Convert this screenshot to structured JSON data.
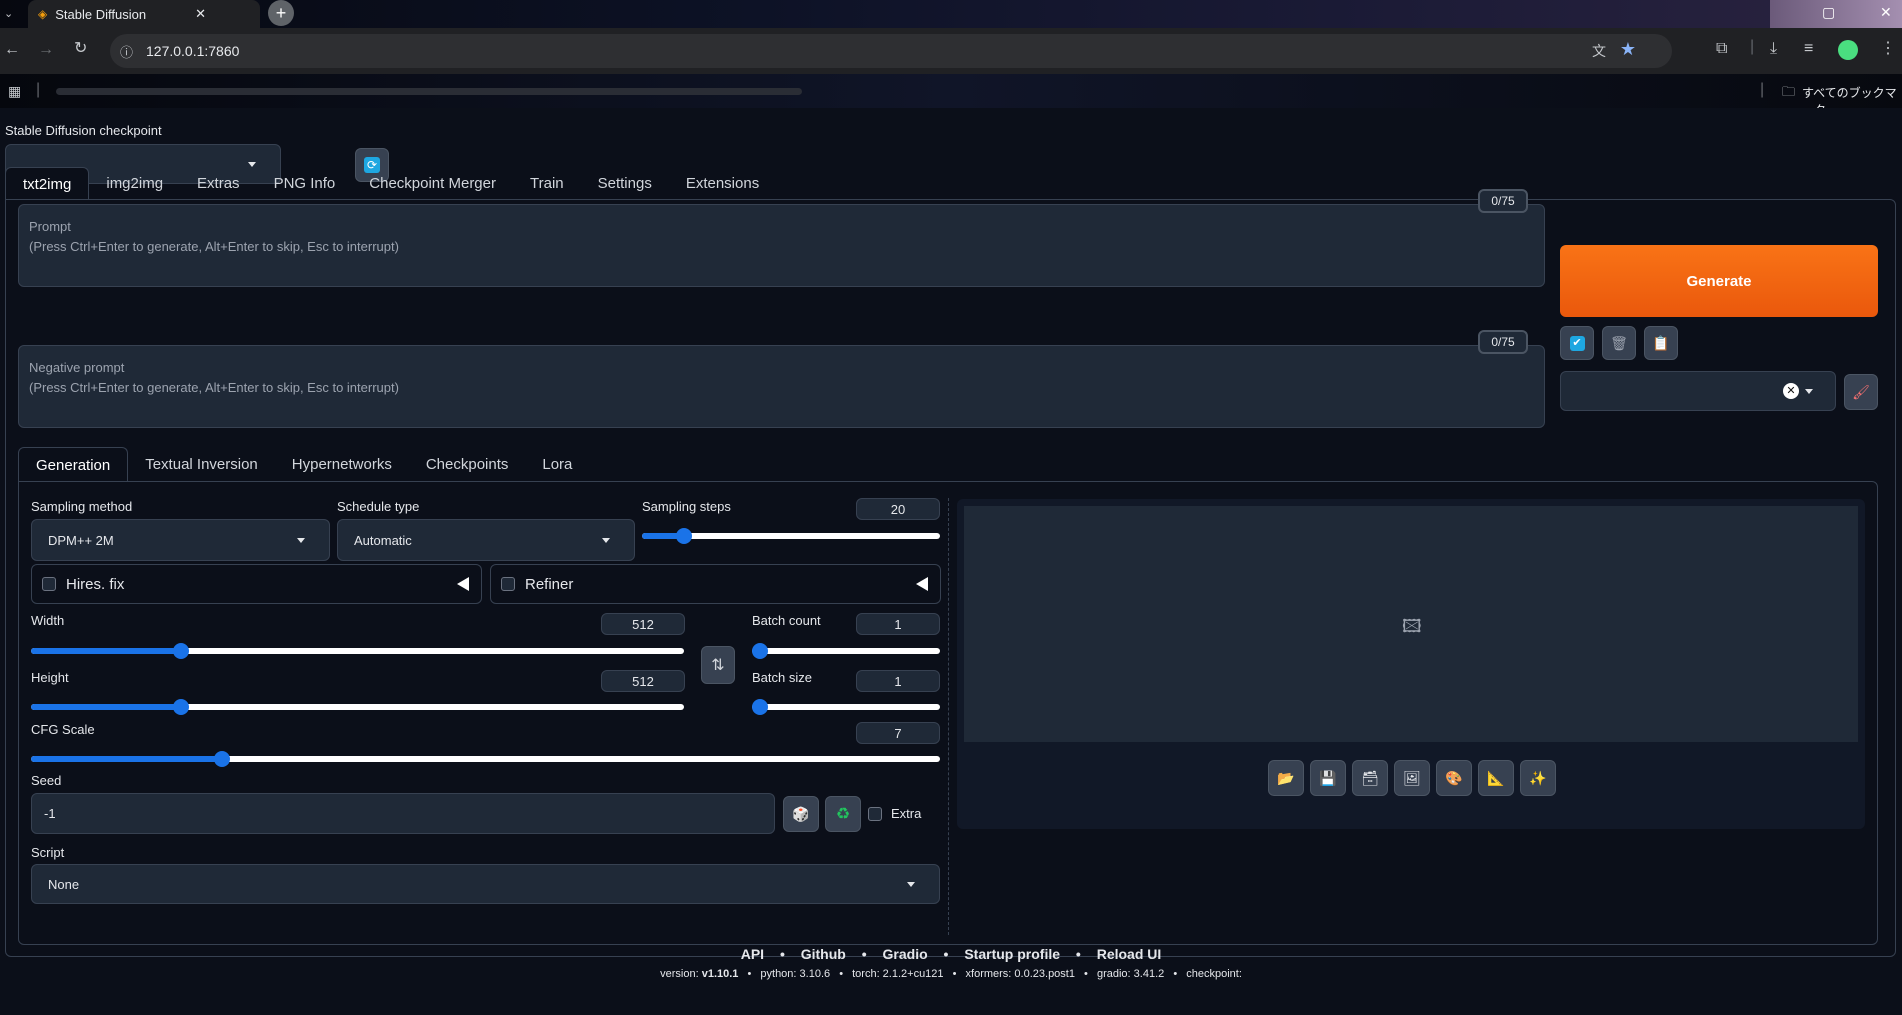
{
  "browser": {
    "tab_title": "Stable Diffusion",
    "url": "127.0.0.1:7860",
    "bookmarks_all": "すべてのブックマーク"
  },
  "checkpoint": {
    "label": "Stable Diffusion checkpoint",
    "value": ""
  },
  "main_tabs": [
    "txt2img",
    "img2img",
    "Extras",
    "PNG Info",
    "Checkpoint Merger",
    "Train",
    "Settings",
    "Extensions"
  ],
  "prompt": {
    "placeholder_title": "Prompt",
    "placeholder_hint": "(Press Ctrl+Enter to generate, Alt+Enter to skip, Esc to interrupt)",
    "counter": "0/75"
  },
  "negative_prompt": {
    "placeholder_title": "Negative prompt",
    "placeholder_hint": "(Press Ctrl+Enter to generate, Alt+Enter to skip, Esc to interrupt)",
    "counter": "0/75"
  },
  "generate_label": "Generate",
  "sub_tabs": [
    "Generation",
    "Textual Inversion",
    "Hypernetworks",
    "Checkpoints",
    "Lora"
  ],
  "params": {
    "sampling_method_label": "Sampling method",
    "sampling_method": "DPM++ 2M",
    "schedule_type_label": "Schedule type",
    "schedule_type": "Automatic",
    "sampling_steps_label": "Sampling steps",
    "sampling_steps": "20",
    "hires_label": "Hires. fix",
    "refiner_label": "Refiner",
    "width_label": "Width",
    "width": "512",
    "height_label": "Height",
    "height": "512",
    "batch_count_label": "Batch count",
    "batch_count": "1",
    "batch_size_label": "Batch size",
    "batch_size": "1",
    "cfg_label": "CFG Scale",
    "cfg": "7",
    "seed_label": "Seed",
    "seed": "-1",
    "extra_label": "Extra",
    "script_label": "Script",
    "script": "None"
  },
  "sliders": {
    "sampling_steps": 0.14,
    "width": 0.23,
    "height": 0.23,
    "batch_count": 0.0,
    "batch_size": 0.0,
    "cfg": 0.21
  },
  "footer": {
    "links": [
      "API",
      "Github",
      "Gradio",
      "Startup profile",
      "Reload UI"
    ],
    "version_label": "version:",
    "version": "v1.10.1",
    "python": "python: 3.10.6",
    "torch": "torch: 2.1.2+cu121",
    "xformers": "xformers: 0.0.23.post1",
    "gradio": "gradio: 3.41.2",
    "checkpoint": "checkpoint:"
  },
  "colors": {
    "accent": "#1a73e8",
    "generate": "#f26b1d",
    "background": "#0b0f19"
  }
}
